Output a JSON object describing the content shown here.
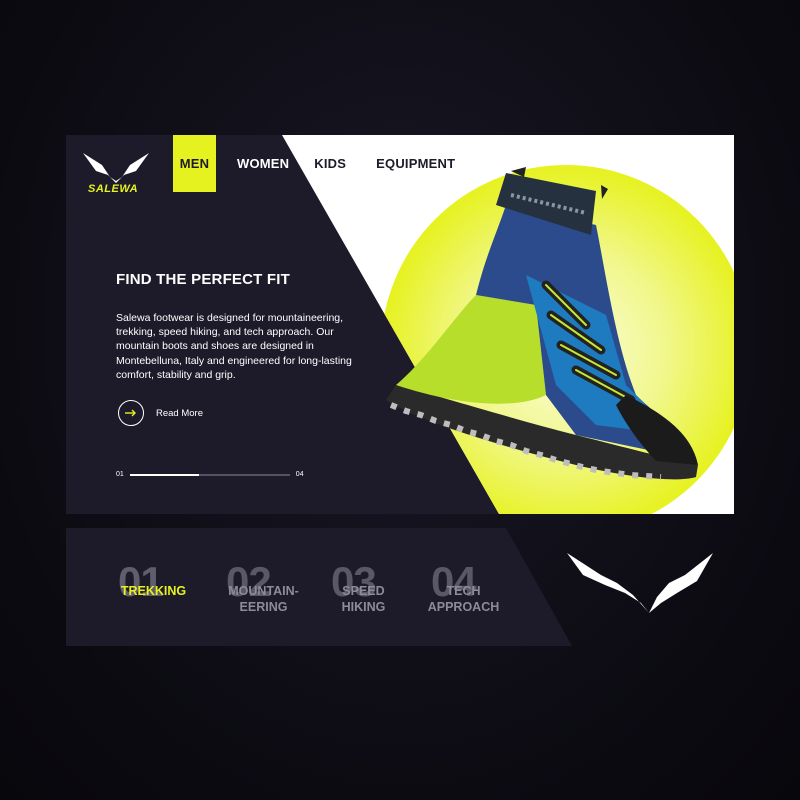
{
  "brand": {
    "name": "SALEWA"
  },
  "nav": {
    "items": [
      {
        "label": "MEN",
        "active": true
      },
      {
        "label": "WOMEN",
        "active": false
      },
      {
        "label": "KIDS",
        "active": false
      },
      {
        "label": "EQUIPMENT",
        "active": false
      }
    ]
  },
  "hero": {
    "headline": "FIND THE PERFECT FIT",
    "description": "Salewa footwear is designed for mountaineering, trekking, speed hiking, and tech approach. Our mountain boots and shoes are designed in Montebelluna, Italy and engineered for long-lasting comfort, stability and grip.",
    "read_more": "Read More",
    "pager": {
      "start": "01",
      "end": "04",
      "progress": 0.43
    }
  },
  "categories": [
    {
      "number": "01",
      "label": "TREKKING",
      "active": true
    },
    {
      "number": "02",
      "label": "MOUNTAIN-\nEERING",
      "active": false
    },
    {
      "number": "03",
      "label": "SPEED\nHIKING",
      "active": false
    },
    {
      "number": "04",
      "label": "TECH\nAPPROACH",
      "active": false
    }
  ],
  "colors": {
    "accent": "#e6f21f",
    "panel": "#1d1b29",
    "background": "#0c0b12"
  },
  "icons": [
    "salewa-eagle-logo-icon",
    "arrow-right-icon",
    "boot-product-image"
  ]
}
